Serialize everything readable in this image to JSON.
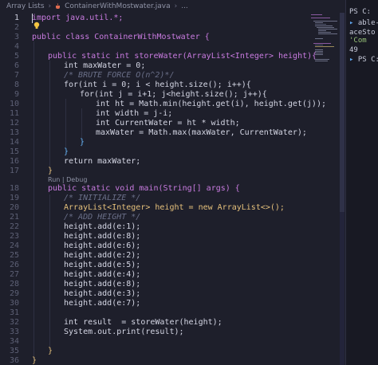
{
  "breadcrumb": {
    "folder": "Array Lists",
    "file": "ContainerWithMostwater.java",
    "more": "..."
  },
  "editor": {
    "line_numbers": [
      "1",
      "2",
      "3",
      "4",
      "5",
      "6",
      "7",
      "8",
      "9",
      "10",
      "11",
      "12",
      "13",
      "14",
      "15",
      "16",
      "17",
      "18",
      "19",
      "20",
      "21",
      "22",
      "23",
      "24",
      "25",
      "26",
      "27",
      "28",
      "29",
      "30",
      "31",
      "32",
      "33",
      "34",
      "35",
      "36"
    ],
    "codelens": "Run | Debug",
    "code": {
      "l1": "import java.util.*;",
      "l3": "public class ContainerWithMostwater {",
      "l5": "public static int storeWater(ArrayList<Integer> height){",
      "l6": "int maxWater = 0;",
      "l7": "/* BRUTE FORCE O(n^2)*/",
      "l8": "for(int i = 0; i < height.size(); i++){",
      "l9": "for(int j = i+1; j<height.size(); j++){",
      "l10": "int ht = Math.min(height.get(i), height.get(j));",
      "l11": "int width = j-i;",
      "l12": "int CurrentWater = ht * width;",
      "l13": "maxWater = Math.max(maxWater, CurrentWater);",
      "l14": "}",
      "l15": "}",
      "l16": "return maxWater;",
      "l17": "}",
      "l18": "public static void main(String[] args) {",
      "l19": "/* INITIALIZE */",
      "l20": "ArrayList<Integer> height = new ArrayList<>();",
      "l21": "/* ADD HEIGHT */",
      "l22": "height.add(e:1);",
      "l23": "height.add(e:8);",
      "l24": "height.add(e:6);",
      "l25": "height.add(e:2);",
      "l26": "height.add(e:5);",
      "l27": "height.add(e:4);",
      "l28": "height.add(e:8);",
      "l29": "height.add(e:3);",
      "l30": "height.add(e:7);",
      "l32": "int result  = storeWater(height);",
      "l33": "System.out.print(result);",
      "l35": "}",
      "l36": "}"
    }
  },
  "terminal": {
    "lines": [
      "PS C:",
      "able-g",
      "aceSto",
      "'Com",
      "49",
      "PS C:"
    ]
  },
  "colors": {
    "background": "#1e1f2b",
    "keyword": "#c97be0",
    "type": "#e5c07b",
    "function": "#61afef",
    "comment": "#6a6f88"
  }
}
